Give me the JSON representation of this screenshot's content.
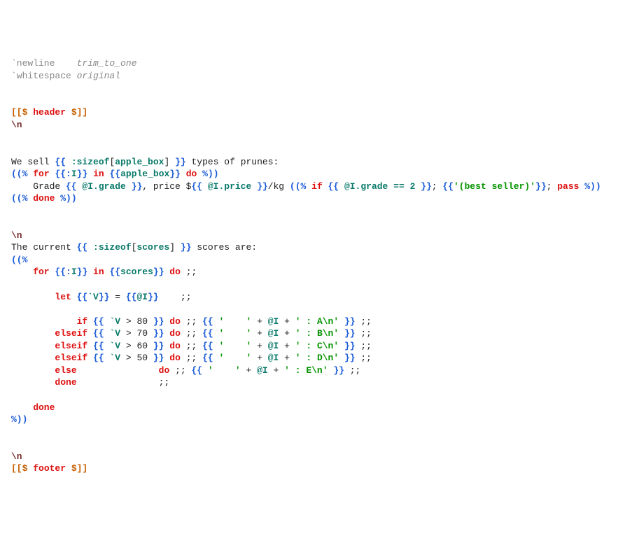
{
  "l1": {
    "a": "`newline    ",
    "b": "trim_to_one"
  },
  "l2": {
    "a": "`whitespace ",
    "b": "original"
  },
  "header": {
    "open": "[[$ ",
    "name": "header",
    "close": " $]]"
  },
  "nl": "\\n",
  "sell1": {
    "a": "We sell ",
    "b": "{{ ",
    "c": ":sizeof",
    "d": "[",
    "e": "apple_box",
    "f": "] ",
    "g": "}}",
    "h": " types of prunes:"
  },
  "for1": {
    "a": "((% ",
    "b": "for ",
    "c": "{{:",
    "d": "I",
    "e": "}}",
    "f": " in ",
    "g": "{{",
    "h": "apple_box",
    "i": "}}",
    "j": " do ",
    "k": "%))"
  },
  "grade": {
    "a": "    Grade ",
    "b": "{{ ",
    "c": "@I.grade ",
    "d": "}}",
    "e": ", price $",
    "f": "{{ ",
    "g": "@I.price ",
    "h": "}}",
    "i": "/kg ",
    "j": "((% ",
    "k": "if ",
    "l": "{{ ",
    "m": "@I.grade == 2 ",
    "n": "}}",
    "o": "; ",
    "p": "{{",
    "q": "'(best seller)'",
    "r": "}}",
    "s": "; ",
    "t": "pass ",
    "u": "%))"
  },
  "done1": {
    "a": "((% ",
    "b": "done ",
    "c": "%))"
  },
  "sc1": {
    "a": "The current ",
    "b": "{{ ",
    "c": ":sizeof",
    "d": "[",
    "e": "scores",
    "f": "] ",
    "g": "}}",
    "h": " scores are:"
  },
  "open": "((%",
  "for2": {
    "a": "    for ",
    "b": "{{:",
    "c": "I",
    "d": "}}",
    "e": " in ",
    "f": "{{",
    "g": "scores",
    "h": "}}",
    "i": " do ",
    "j": ";;"
  },
  "let": {
    "a": "        let ",
    "b": "{{",
    "c": "`V",
    "d": "}}",
    "e": " = ",
    "f": "{{",
    "g": "@I",
    "h": "}}",
    "i": "    ;;"
  },
  "r1": {
    "kw": "            if ",
    "o": "{{ ",
    "v": "`V",
    "cmp": " > 80 ",
    "c": "}}",
    "do": " do ",
    "sc": ";;",
    "sp": " ",
    "o2": "{{ ",
    "q": "'    '",
    "pl": " + ",
    "at": "@I",
    "pl2": " + ",
    "q2": "' : A\\n' ",
    "c2": "}}",
    "sc2": " ;;"
  },
  "r2": {
    "kw": "        elseif ",
    "o": "{{ ",
    "v": "`V",
    "cmp": " > 70 ",
    "c": "}}",
    "do": " do ",
    "sc": ";;",
    "sp": " ",
    "o2": "{{ ",
    "q": "'    '",
    "pl": " + ",
    "at": "@I",
    "pl2": " + ",
    "q2": "' : B\\n' ",
    "c2": "}}",
    "sc2": " ;;"
  },
  "r3": {
    "kw": "        elseif ",
    "o": "{{ ",
    "v": "`V",
    "cmp": " > 60 ",
    "c": "}}",
    "do": " do ",
    "sc": ";;",
    "sp": " ",
    "o2": "{{ ",
    "q": "'    '",
    "pl": " + ",
    "at": "@I",
    "pl2": " + ",
    "q2": "' : C\\n' ",
    "c2": "}}",
    "sc2": " ;;"
  },
  "r4": {
    "kw": "        elseif ",
    "o": "{{ ",
    "v": "`V",
    "cmp": " > 50 ",
    "c": "}}",
    "do": " do ",
    "sc": ";;",
    "sp": " ",
    "o2": "{{ ",
    "q": "'    '",
    "pl": " + ",
    "at": "@I",
    "pl2": " + ",
    "q2": "' : D\\n' ",
    "c2": "}}",
    "sc2": " ;;"
  },
  "r5": {
    "kw": "        else              ",
    "do": " do ",
    "sc": ";;",
    "sp": " ",
    "o2": "{{ ",
    "q": "'    '",
    "pl": " + ",
    "at": "@I",
    "pl2": " + ",
    "q2": "' : E\\n' ",
    "c2": "}}",
    "sc2": " ;;"
  },
  "done2": {
    "a": "        done              ",
    "b": " ;;"
  },
  "done3": "    done",
  "close": "%))",
  "footer": {
    "open": "[[$ ",
    "name": "footer",
    "close": " $]]"
  }
}
